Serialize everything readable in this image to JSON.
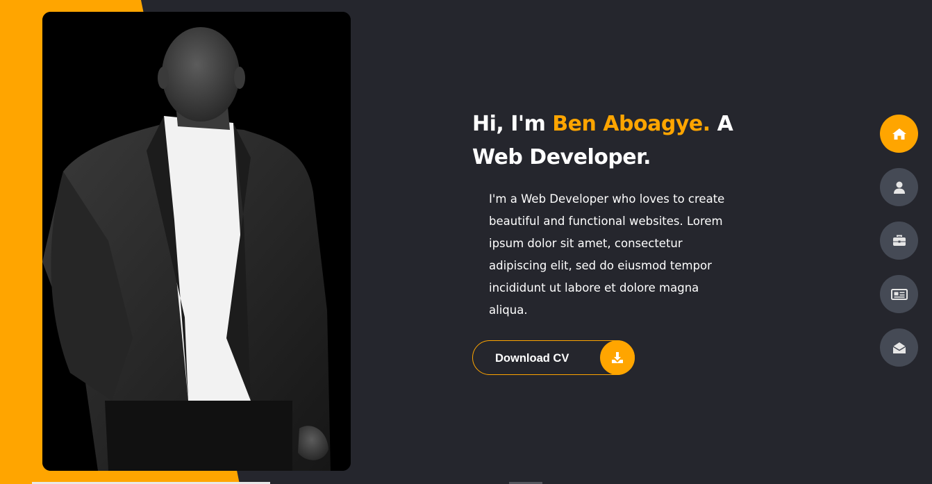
{
  "hero": {
    "title_prefix": "Hi, I'm ",
    "name": "Ben Aboagye.",
    "title_suffix": " A Web Developer.",
    "description": "I'm a Web Developer who loves to create beautiful and functional websites. Lorem ipsum dolor sit amet, consectetur adipiscing elit, sed do eiusmod tempor incididunt ut labore et dolore magna aliqua."
  },
  "download": {
    "label": "Download CV",
    "icon": "download-icon"
  },
  "nav": [
    {
      "id": "home",
      "icon": "home-icon",
      "active": true
    },
    {
      "id": "about",
      "icon": "user-icon",
      "active": false
    },
    {
      "id": "portfolio",
      "icon": "briefcase-icon",
      "active": false
    },
    {
      "id": "blog",
      "icon": "newspaper-icon",
      "active": false
    },
    {
      "id": "contact",
      "icon": "envelope-open-icon",
      "active": false
    }
  ],
  "colors": {
    "accent": "#ffa500",
    "background": "#25262d",
    "nav_inactive": "#454a55"
  }
}
